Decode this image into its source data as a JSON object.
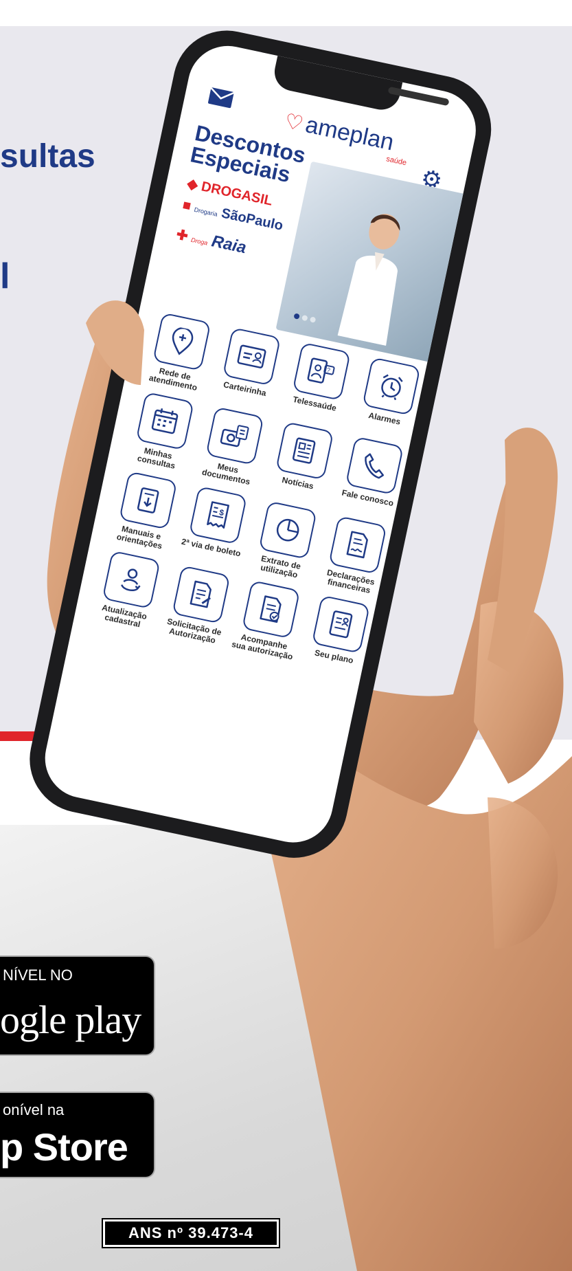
{
  "headline": {
    "line1": "sultas",
    "line2": "l"
  },
  "app": {
    "brand_name": "ameplan",
    "brand_sub": "saúde",
    "promo": {
      "title_line1": "Descontos",
      "title_line2": "Especiais",
      "brands": [
        "DROGASIL",
        "Drogaria",
        "SãoPaulo",
        "Droga",
        "Raia"
      ]
    },
    "tiles": [
      {
        "label": "Rede de atendimento",
        "icon": "location-plus-icon"
      },
      {
        "label": "Carteirinha",
        "icon": "id-card-icon"
      },
      {
        "label": "Telessaúde",
        "icon": "telehealth-icon"
      },
      {
        "label": "Alarmes",
        "icon": "alarm-clock-icon"
      },
      {
        "label": "Minhas consultas",
        "icon": "calendar-icon"
      },
      {
        "label": "Meus documentos",
        "icon": "camera-document-icon"
      },
      {
        "label": "Notícias",
        "icon": "newspaper-icon"
      },
      {
        "label": "Fale conosco",
        "icon": "phone-icon"
      },
      {
        "label": "Manuais e orientações",
        "icon": "manual-download-icon"
      },
      {
        "label": "2ª via de boleto",
        "icon": "receipt-dollar-icon"
      },
      {
        "label": "Extrato de utilização",
        "icon": "pie-chart-icon"
      },
      {
        "label": "Declarações financeiras",
        "icon": "signed-document-icon"
      },
      {
        "label": "Atualização cadastral",
        "icon": "user-refresh-icon"
      },
      {
        "label": "Solicitação de Autorização",
        "icon": "document-edit-icon"
      },
      {
        "label": "Acompanhe sua autorização",
        "icon": "document-check-icon"
      },
      {
        "label": "Seu plano",
        "icon": "plan-card-icon"
      }
    ]
  },
  "stores": {
    "google_small": "NÍVEL NO",
    "google_big": "ogle play",
    "apple_small": "onível na",
    "apple_big": "p Store"
  },
  "ans_label": "ANS nº 39.473-4",
  "colors": {
    "navy": "#1f3a86",
    "red": "#e0252b",
    "panel": "#e9e8ee"
  }
}
